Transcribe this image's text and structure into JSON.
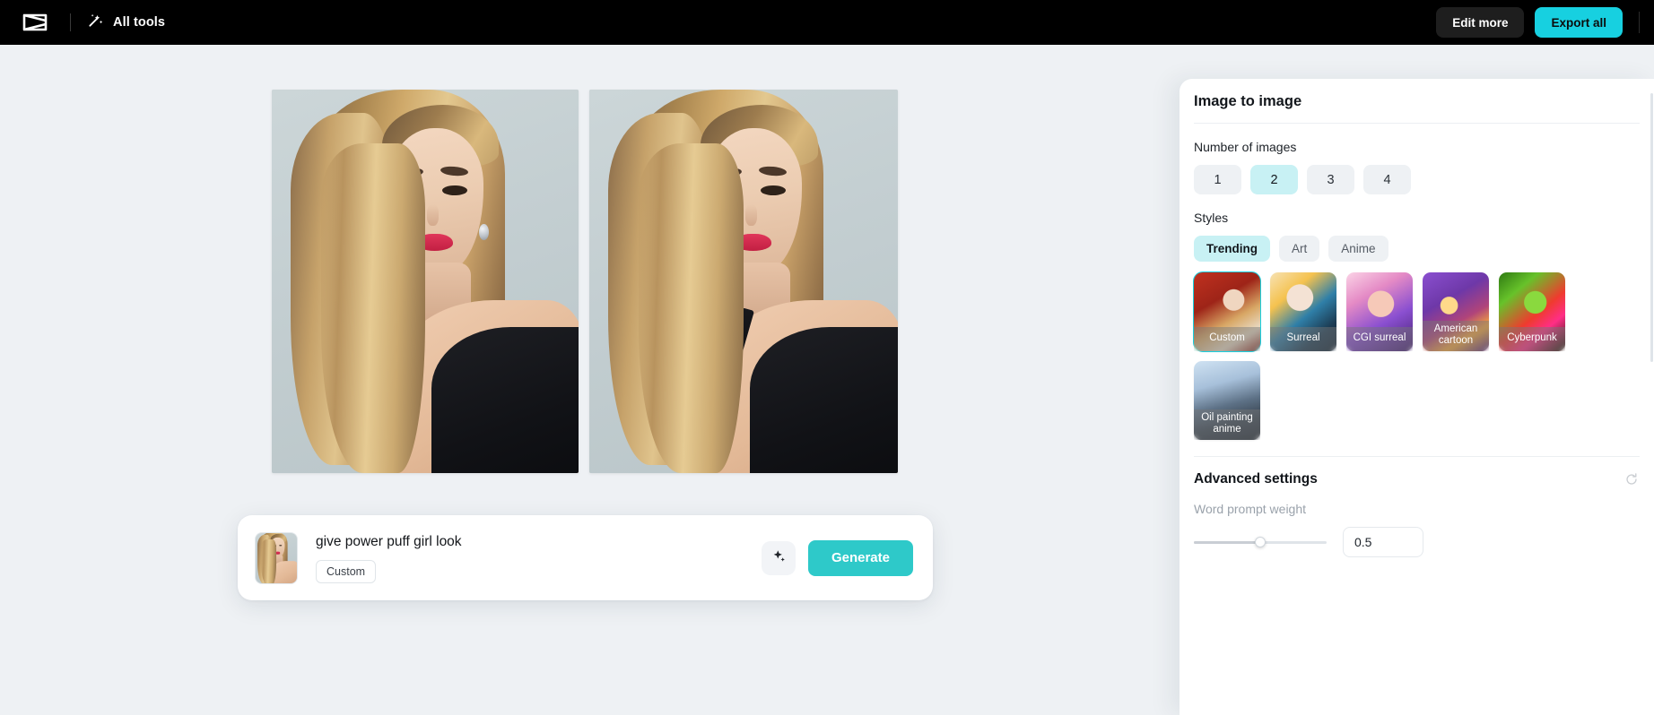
{
  "topbar": {
    "logo_icon": "capcut-logo-icon",
    "all_tools_icon": "magic-wand-icon",
    "all_tools_label": "All tools",
    "edit_more_label": "Edit more",
    "export_all_label": "Export all",
    "accent_color": "#17d0e0",
    "background_color": "#000000"
  },
  "canvas": {
    "images": [
      {
        "alt": "generated-portrait-1"
      },
      {
        "alt": "generated-portrait-2"
      }
    ]
  },
  "prompt_bar": {
    "thumbnail_alt": "source-image-thumbnail",
    "prompt_text": "give power puff girl look",
    "style_tag": "Custom",
    "magic_icon": "sparkle-icon",
    "generate_label": "Generate",
    "generate_color": "#2ec9c9"
  },
  "sidebar": {
    "title": "Image to image",
    "number_of_images": {
      "label": "Number of images",
      "options": [
        "1",
        "2",
        "3",
        "4"
      ],
      "selected": "2"
    },
    "styles": {
      "label": "Styles",
      "tabs": [
        {
          "label": "Trending",
          "active": true
        },
        {
          "label": "Art",
          "active": false
        },
        {
          "label": "Anime",
          "active": false
        }
      ],
      "cards": [
        {
          "label": "Custom",
          "selected": true,
          "two_line": false,
          "c1": "#b32b1e",
          "c2": "#e0c9a8",
          "c3": "#6d1a14"
        },
        {
          "label": "Surreal",
          "selected": false,
          "two_line": false,
          "c1": "#f2d27a",
          "c2": "#2f7fa8",
          "c3": "#1b2b3a"
        },
        {
          "label": "CGI surreal",
          "selected": false,
          "two_line": false,
          "c1": "#f7b8d8",
          "c2": "#8a4fd0",
          "c3": "#3c1f63"
        },
        {
          "label": "American cartoon",
          "selected": false,
          "two_line": true,
          "c1": "#f6a93b",
          "c2": "#8a4fd0",
          "c3": "#3a1e52"
        },
        {
          "label": "Cyberpunk",
          "selected": false,
          "two_line": false,
          "c1": "#ff3b30",
          "c2": "#3bd65a",
          "c3": "#1b1a10"
        },
        {
          "label": "Oil painting anime",
          "selected": false,
          "two_line": true,
          "c1": "#cfe0ef",
          "c2": "#6f7f95",
          "c3": "#2b3440"
        }
      ]
    },
    "advanced": {
      "title": "Advanced settings",
      "reset_icon": "reset-icon",
      "word_prompt_weight_label": "Word prompt weight",
      "word_prompt_weight_value": "0.5",
      "slider_percent": 50
    }
  }
}
